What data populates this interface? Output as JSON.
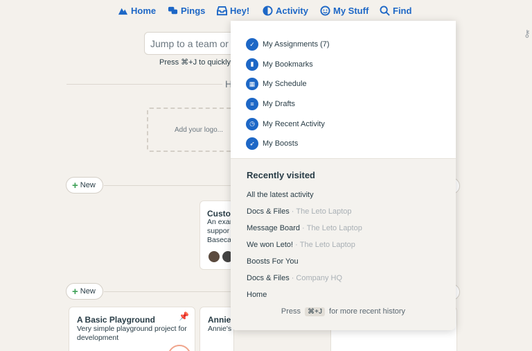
{
  "nav": {
    "items": [
      {
        "label": "Home",
        "icon": "mountain-icon"
      },
      {
        "label": "Pings",
        "icon": "chat-bubbles-icon"
      },
      {
        "label": "Hey!",
        "icon": "inbox-icon"
      },
      {
        "label": "Activity",
        "icon": "activity-icon"
      },
      {
        "label": "My Stuff",
        "icon": "face-icon"
      },
      {
        "label": "Find",
        "icon": "search-icon"
      }
    ],
    "accent": "#1d67c6"
  },
  "jump": {
    "placeholder_visible": "Jump to a team or p",
    "hint_visible": "Press ⌘+J to quickly j"
  },
  "hq_heading_visible": "H",
  "logo_placeholder": "Add your logo...",
  "sections": {
    "new_label": "New"
  },
  "cards": {
    "custom": {
      "title_visible": "Custo",
      "desc_lines": [
        "An exar",
        "suppor",
        "Baseca"
      ]
    },
    "playground": {
      "title": "A Basic Playground",
      "desc": "Very simple playground project for development"
    },
    "annie": {
      "title_visible": "Annie",
      "desc_visible": "Annie's"
    }
  },
  "my_stuff_menu": {
    "items": [
      {
        "label": "My Assignments (7)",
        "icon": "checkmark-icon"
      },
      {
        "label": "My Bookmarks",
        "icon": "bookmark-icon"
      },
      {
        "label": "My Schedule",
        "icon": "calendar-icon"
      },
      {
        "label": "My Drafts",
        "icon": "drafts-icon"
      },
      {
        "label": "My Recent Activity",
        "icon": "clock-icon"
      },
      {
        "label": "My Boosts",
        "icon": "rocket-icon"
      }
    ],
    "recently_visited": {
      "title": "Recently visited",
      "items": [
        {
          "label": "All the latest activity",
          "project": ""
        },
        {
          "label": "Docs & Files",
          "project": "The Leto Laptop"
        },
        {
          "label": "Message Board",
          "project": "The Leto Laptop"
        },
        {
          "label": "We won Leto!",
          "project": "The Leto Laptop"
        },
        {
          "label": "Boosts For You",
          "project": ""
        },
        {
          "label": "Docs & Files",
          "project": "Company HQ"
        },
        {
          "label": "Home",
          "project": ""
        }
      ],
      "footer_before": "Press",
      "footer_key": "⌘+J",
      "footer_after": "for more recent history"
    }
  }
}
